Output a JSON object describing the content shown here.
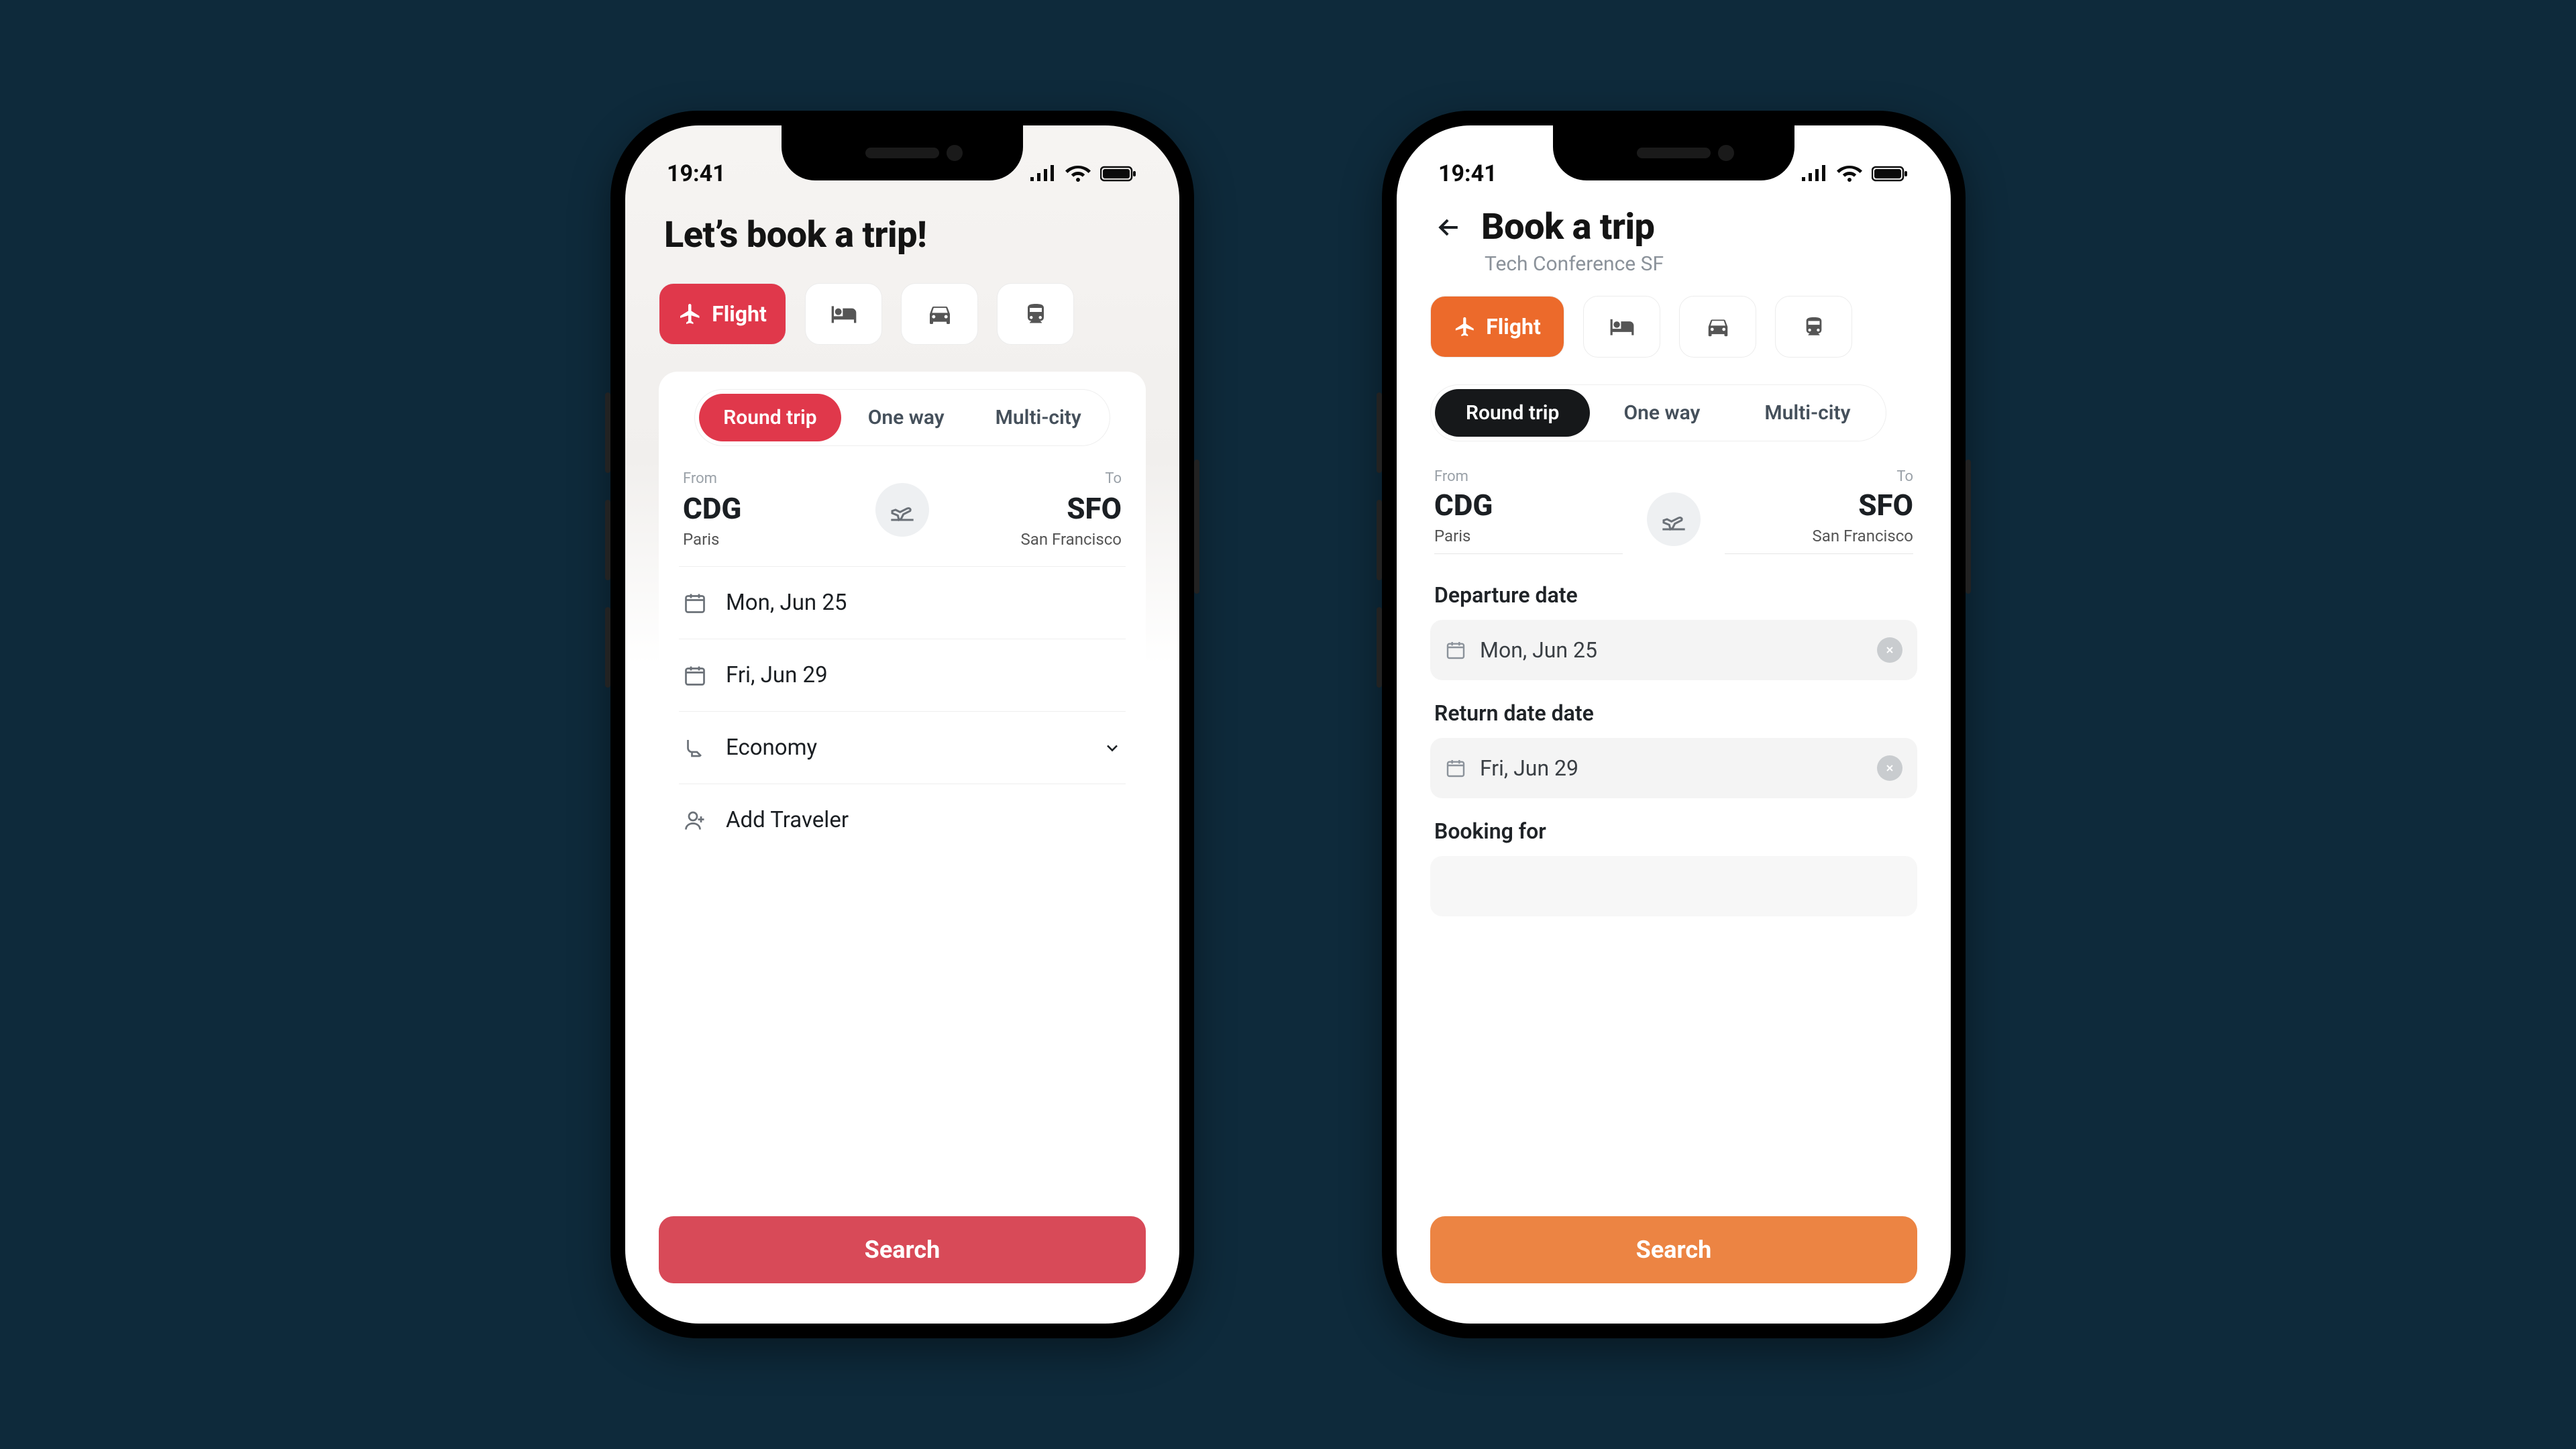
{
  "status_time": "19:41",
  "modes": {
    "flight": "Flight"
  },
  "trip_types": {
    "round": "Round trip",
    "oneway": "One way",
    "multi": "Multi-city"
  },
  "phone_a": {
    "headline": "Let’s book a trip!",
    "from_label": "From",
    "from_code": "CDG",
    "from_city": "Paris",
    "to_label": "To",
    "to_code": "SFO",
    "to_city": "San Francisco",
    "depart_date": "Mon, Jun 25",
    "return_date": "Fri, Jun 29",
    "cabin": "Economy",
    "add_traveler": "Add Traveler",
    "search": "Search"
  },
  "phone_b": {
    "title": "Book a trip",
    "subtitle": "Tech Conference SF",
    "from_label": "From",
    "from_code": "CDG",
    "from_city": "Paris",
    "to_label": "To",
    "to_code": "SFO",
    "to_city": "San Francisco",
    "depart_label": "Departure date",
    "depart_value": "Mon, Jun 25",
    "return_label": "Return date date",
    "return_value": "Fri, Jun 29",
    "booking_for_label": "Booking for",
    "search": "Search"
  }
}
